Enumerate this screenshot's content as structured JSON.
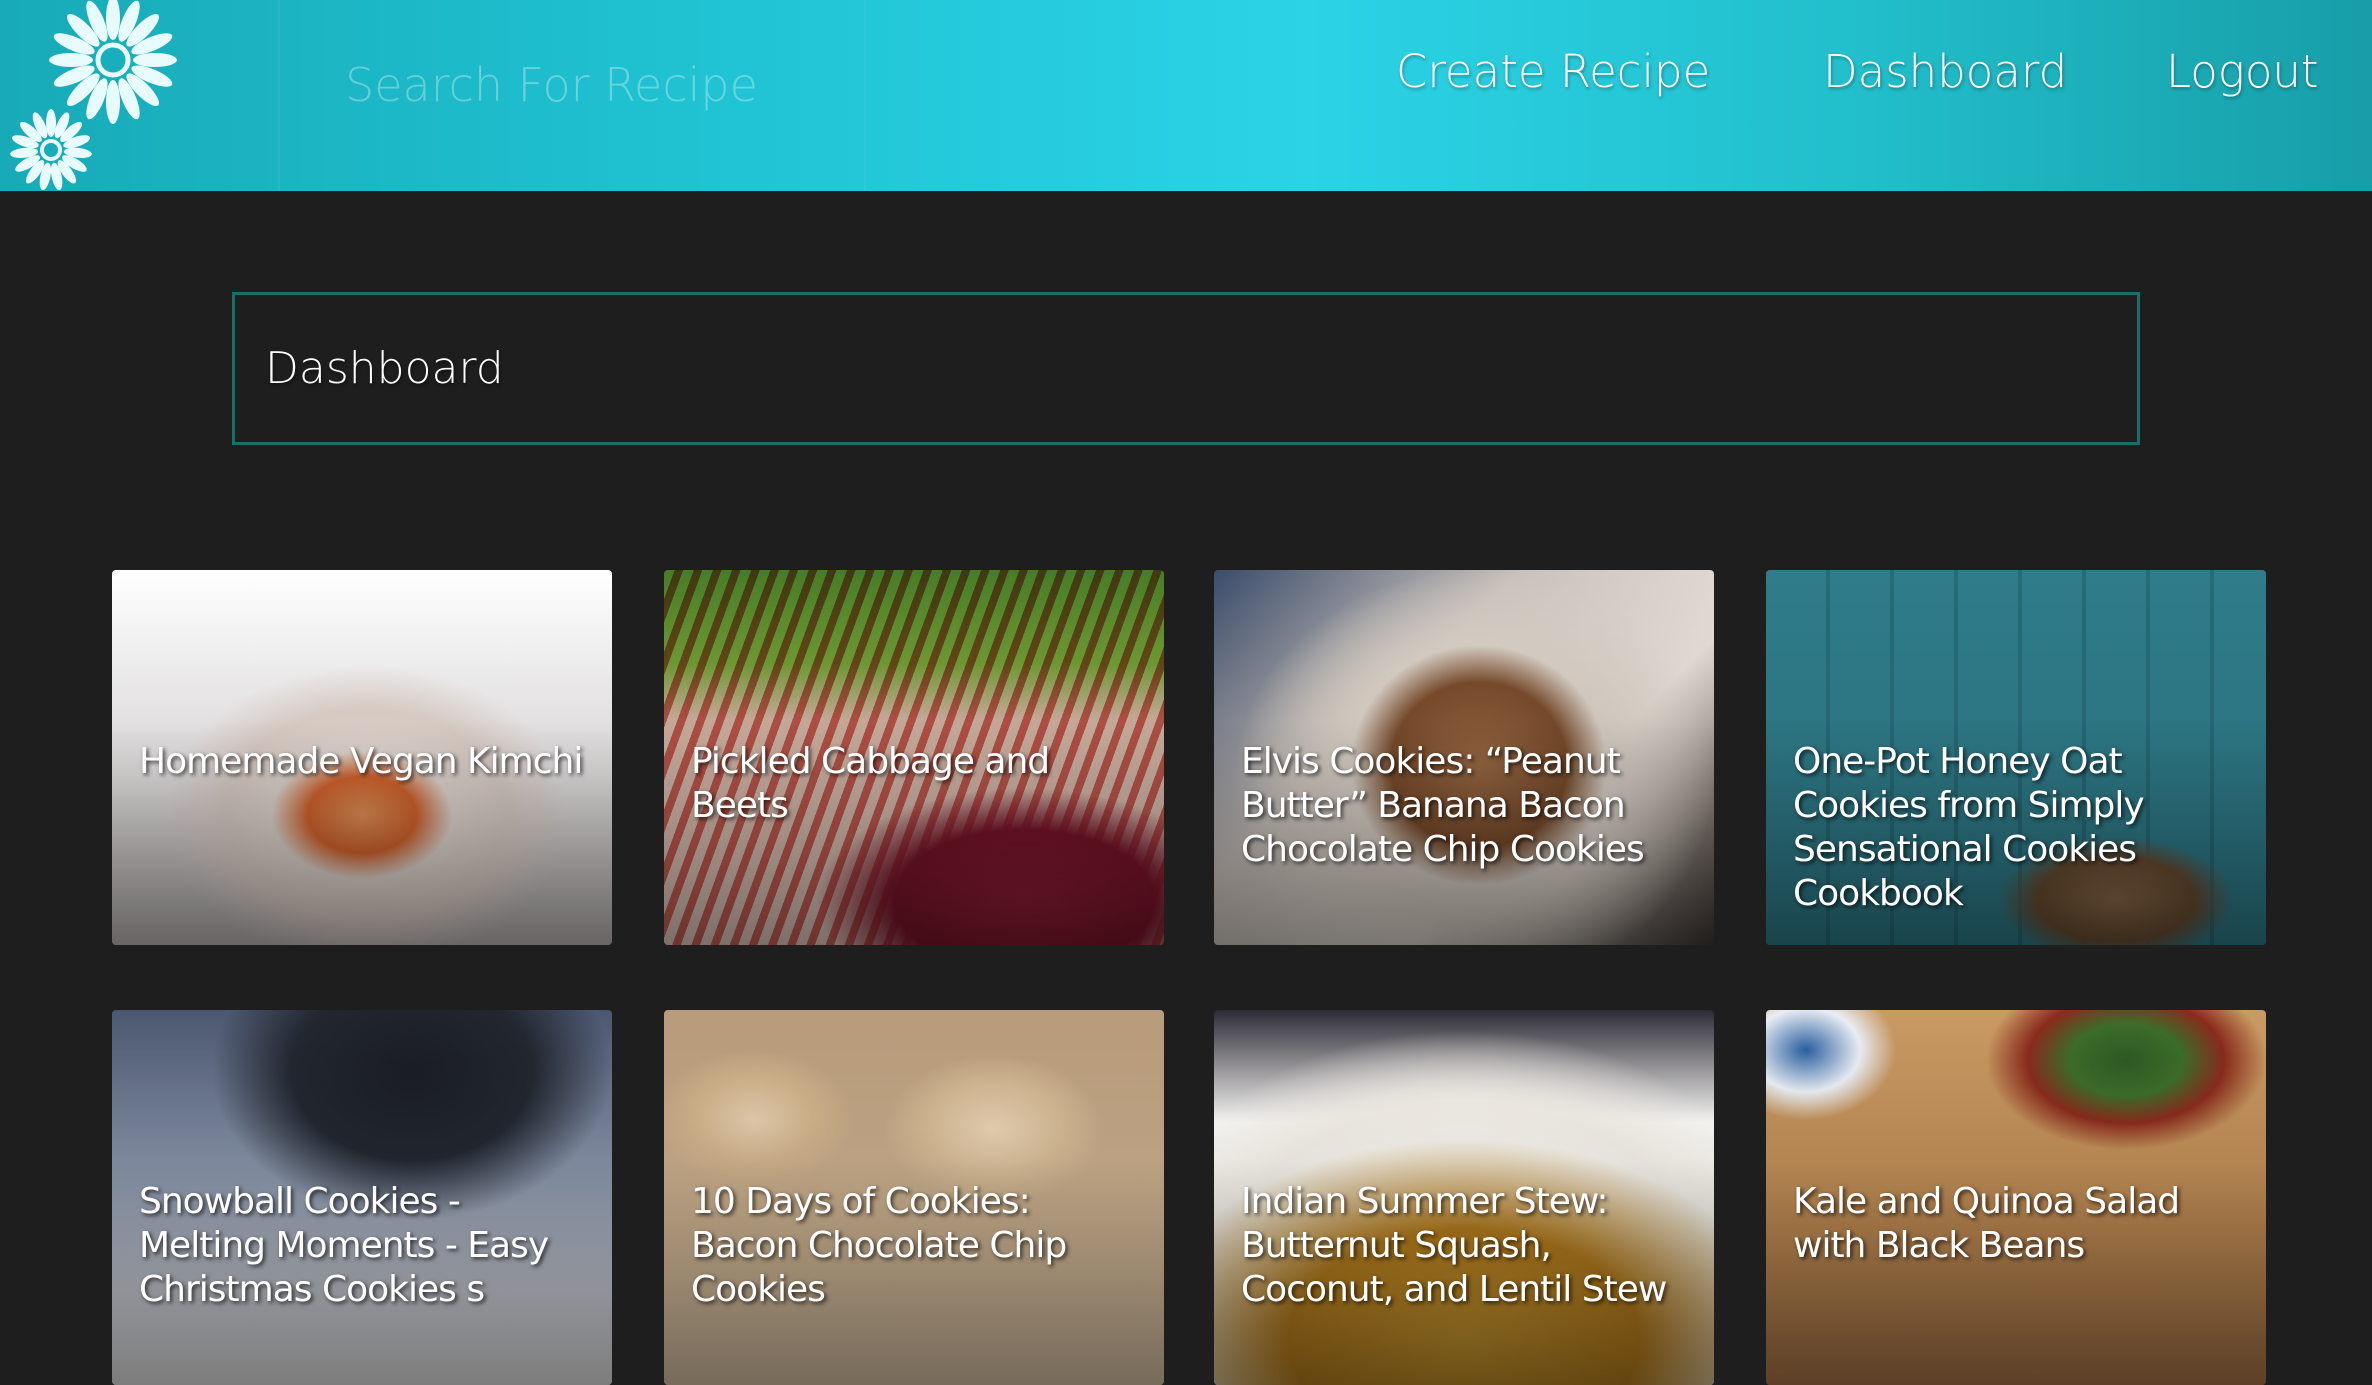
{
  "header": {
    "search_placeholder": "Search For Recipe",
    "nav": [
      {
        "label": "Create Recipe"
      },
      {
        "label": "Dashboard"
      },
      {
        "label": "Logout"
      }
    ]
  },
  "dashboard": {
    "title": "Dashboard"
  },
  "recipes": [
    {
      "title": "Homemade Vegan Kimchi"
    },
    {
      "title": "Pickled Cabbage and Beets"
    },
    {
      "title": "Elvis Cookies: “Peanut Butter” Banana Bacon Chocolate Chip Cookies"
    },
    {
      "title": "One-Pot Honey Oat Cookies from Simply Sensational Cookies Cookbook"
    },
    {
      "title": "Snowball Cookies - Melting Moments - Easy Christmas Cookies s"
    },
    {
      "title": "10 Days of Cookies: Bacon Chocolate Chip Cookies"
    },
    {
      "title": "Indian Summer Stew: Butternut Squash, Coconut, and Lentil Stew"
    },
    {
      "title": "Kale and Quinoa Salad with Black Beans"
    }
  ],
  "colors": {
    "header_accent": "#2bd3e6",
    "page_background": "#1e1e1e",
    "dashboard_border": "#1c6e6a"
  },
  "icons": {
    "logo": "flower-logo-icon"
  }
}
